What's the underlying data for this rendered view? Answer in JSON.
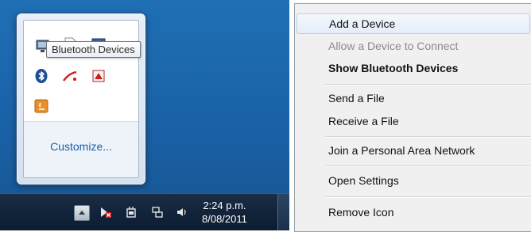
{
  "tray_flyout": {
    "tooltip": "Bluetooth Devices",
    "customize_link": "Customize...",
    "icons": [
      "network-icon",
      "document-icon",
      "monitor-icon",
      "bluetooth-icon",
      "acrobat-icon",
      "pdf-icon",
      "java-icon"
    ]
  },
  "taskbar": {
    "time": "2:24 p.m.",
    "date": "8/08/2011",
    "icons": [
      "show-hidden-icons-arrow",
      "action-center-error-icon",
      "power-icon",
      "network-icon",
      "volume-icon"
    ]
  },
  "context_menu": {
    "items": [
      {
        "label": "Add a Device",
        "state": "hover"
      },
      {
        "label": "Allow a Device to Connect",
        "state": "disabled"
      },
      {
        "label": "Show Bluetooth Devices",
        "state": "bold"
      },
      {
        "label": "Send a File",
        "state": "normal"
      },
      {
        "label": "Receive a File",
        "state": "normal"
      },
      {
        "label": "Join a Personal Area Network",
        "state": "normal"
      },
      {
        "label": "Open Settings",
        "state": "normal"
      },
      {
        "label": "Remove Icon",
        "state": "normal"
      }
    ]
  },
  "colors": {
    "desktop": "#1a61a7",
    "taskbar": "#11233a",
    "menu_bg": "#f0f0f0",
    "link": "#1c5fa9"
  }
}
